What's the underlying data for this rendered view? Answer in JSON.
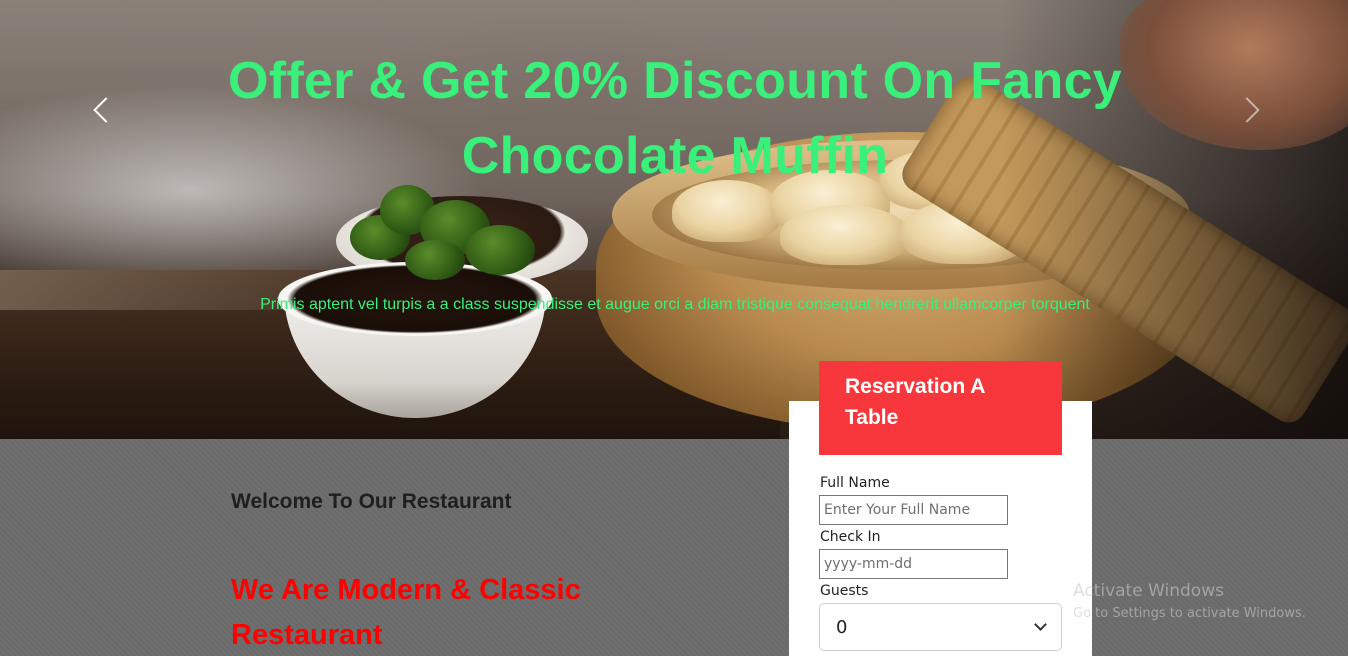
{
  "hero": {
    "title": "Offer & Get 20% Discount On Fancy Chocolate Muffin",
    "subtitle": "Primis aptent vel turpis a a class suspendisse et augue orci a diam tristique consequat hendrerit ullamcorper torquent",
    "title_color": "#39f07a"
  },
  "about": {
    "welcome": "Welcome To Our Restaurant",
    "headline": "We Are Modern & Classic Restaurant",
    "headline_color": "#ff0000"
  },
  "reservation": {
    "title": "Reservation A Table",
    "header_color": "#f7373b",
    "full_name_label": "Full Name",
    "full_name_placeholder": "Enter Your Full Name",
    "check_in_label": "Check In",
    "check_in_placeholder": "yyyy-mm-dd",
    "guests_label": "Guests",
    "guests_value": "0"
  },
  "watermark": {
    "line1": "Activate Windows",
    "line2": "Go to Settings to activate Windows."
  },
  "icons": {
    "prev": "chevron-left-icon",
    "next": "chevron-right-icon",
    "select": "chevron-down-icon"
  }
}
